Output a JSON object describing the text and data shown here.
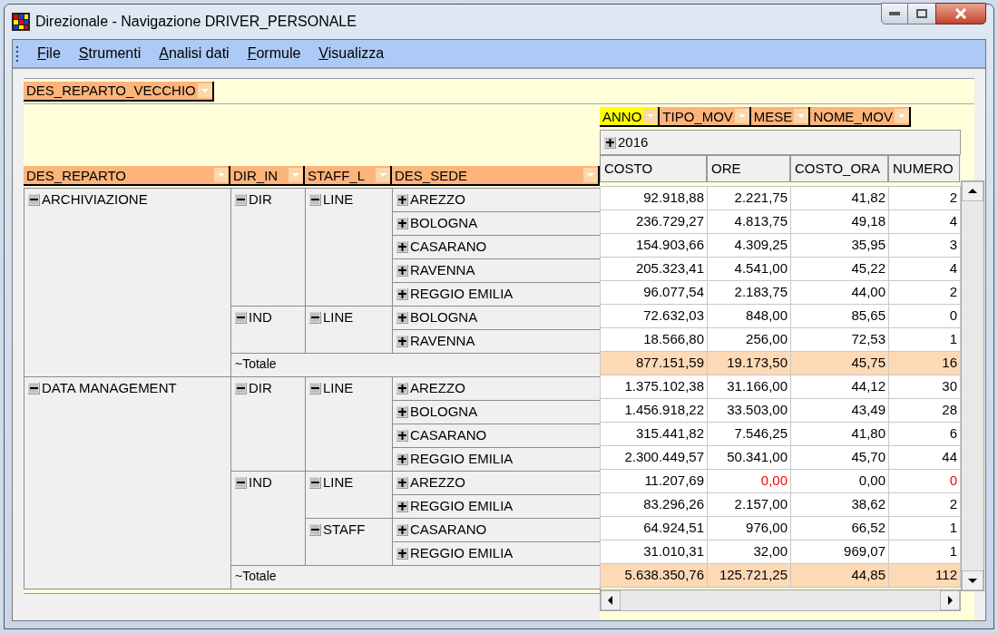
{
  "window": {
    "title": "Direzionale - Navigazione DRIVER_PERSONALE"
  },
  "menu": [
    "File",
    "Strumenti",
    "Analisi dati",
    "Formule",
    "Visualizza"
  ],
  "filter_fields": [
    {
      "label": "DES_REPARTO_VECCHIO",
      "highlighted": false
    }
  ],
  "column_fields": [
    {
      "label": "ANNO",
      "highlighted": true
    },
    {
      "label": "TIPO_MOV",
      "highlighted": false
    },
    {
      "label": "MESE",
      "highlighted": false
    },
    {
      "label": "NOME_MOV",
      "highlighted": false
    }
  ],
  "column_group": {
    "label": "2016",
    "expanded": false
  },
  "row_fields": [
    {
      "label": "DES_REPARTO",
      "highlighted": false
    },
    {
      "label": "DIR_IN",
      "highlighted": false
    },
    {
      "label": "STAFF_L",
      "highlighted": false
    },
    {
      "label": "DES_SEDE",
      "highlighted": false
    }
  ],
  "measures": [
    "COSTO",
    "ORE",
    "COSTO_ORA",
    "NUMERO"
  ],
  "groups": [
    {
      "label": "ARCHIVIAZIONE",
      "expanded": true,
      "children": [
        {
          "label": "DIR",
          "expanded": true,
          "children": [
            {
              "label": "LINE",
              "expanded": true,
              "children": [
                {
                  "label": "AREZZO",
                  "expanded": false,
                  "cells": [
                    {
                      "text": "92.918,88",
                      "alert": false
                    },
                    {
                      "text": "2.221,75",
                      "alert": false
                    },
                    {
                      "text": "41,82",
                      "alert": false
                    },
                    {
                      "text": "2",
                      "alert": false
                    }
                  ]
                },
                {
                  "label": "BOLOGNA",
                  "expanded": false,
                  "cells": [
                    {
                      "text": "236.729,27",
                      "alert": false
                    },
                    {
                      "text": "4.813,75",
                      "alert": false
                    },
                    {
                      "text": "49,18",
                      "alert": false
                    },
                    {
                      "text": "4",
                      "alert": false
                    }
                  ]
                },
                {
                  "label": "CASARANO",
                  "expanded": false,
                  "cells": [
                    {
                      "text": "154.903,66",
                      "alert": false
                    },
                    {
                      "text": "4.309,25",
                      "alert": false
                    },
                    {
                      "text": "35,95",
                      "alert": false
                    },
                    {
                      "text": "3",
                      "alert": false
                    }
                  ]
                },
                {
                  "label": "RAVENNA",
                  "expanded": false,
                  "cells": [
                    {
                      "text": "205.323,41",
                      "alert": false
                    },
                    {
                      "text": "4.541,00",
                      "alert": false
                    },
                    {
                      "text": "45,22",
                      "alert": false
                    },
                    {
                      "text": "4",
                      "alert": false
                    }
                  ]
                },
                {
                  "label": "REGGIO EMILIA",
                  "expanded": false,
                  "cells": [
                    {
                      "text": "96.077,54",
                      "alert": false
                    },
                    {
                      "text": "2.183,75",
                      "alert": false
                    },
                    {
                      "text": "44,00",
                      "alert": false
                    },
                    {
                      "text": "2",
                      "alert": false
                    }
                  ]
                }
              ]
            }
          ]
        },
        {
          "label": "IND",
          "expanded": true,
          "children": [
            {
              "label": "LINE",
              "expanded": true,
              "children": [
                {
                  "label": "BOLOGNA",
                  "expanded": false,
                  "cells": [
                    {
                      "text": "72.632,03",
                      "alert": false
                    },
                    {
                      "text": "848,00",
                      "alert": false
                    },
                    {
                      "text": "85,65",
                      "alert": false
                    },
                    {
                      "text": "0",
                      "alert": false
                    }
                  ]
                },
                {
                  "label": "RAVENNA",
                  "expanded": false,
                  "cells": [
                    {
                      "text": "18.566,80",
                      "alert": false
                    },
                    {
                      "text": "256,00",
                      "alert": false
                    },
                    {
                      "text": "72,53",
                      "alert": false
                    },
                    {
                      "text": "1",
                      "alert": false
                    }
                  ]
                }
              ]
            }
          ]
        }
      ],
      "total": {
        "label": "~Totale",
        "cells": [
          {
            "text": "877.151,59",
            "alert": false
          },
          {
            "text": "19.173,50",
            "alert": false
          },
          {
            "text": "45,75",
            "alert": false
          },
          {
            "text": "16",
            "alert": false
          }
        ]
      }
    },
    {
      "label": "DATA MANAGEMENT",
      "expanded": true,
      "children": [
        {
          "label": "DIR",
          "expanded": true,
          "children": [
            {
              "label": "LINE",
              "expanded": true,
              "children": [
                {
                  "label": "AREZZO",
                  "expanded": false,
                  "cells": [
                    {
                      "text": "1.375.102,38",
                      "alert": false
                    },
                    {
                      "text": "31.166,00",
                      "alert": false
                    },
                    {
                      "text": "44,12",
                      "alert": false
                    },
                    {
                      "text": "30",
                      "alert": false
                    }
                  ]
                },
                {
                  "label": "BOLOGNA",
                  "expanded": false,
                  "cells": [
                    {
                      "text": "1.456.918,22",
                      "alert": false
                    },
                    {
                      "text": "33.503,00",
                      "alert": false
                    },
                    {
                      "text": "43,49",
                      "alert": false
                    },
                    {
                      "text": "28",
                      "alert": false
                    }
                  ]
                },
                {
                  "label": "CASARANO",
                  "expanded": false,
                  "cells": [
                    {
                      "text": "315.441,82",
                      "alert": false
                    },
                    {
                      "text": "7.546,25",
                      "alert": false
                    },
                    {
                      "text": "41,80",
                      "alert": false
                    },
                    {
                      "text": "6",
                      "alert": false
                    }
                  ]
                },
                {
                  "label": "REGGIO EMILIA",
                  "expanded": false,
                  "cells": [
                    {
                      "text": "2.300.449,57",
                      "alert": false
                    },
                    {
                      "text": "50.341,00",
                      "alert": false
                    },
                    {
                      "text": "45,70",
                      "alert": false
                    },
                    {
                      "text": "44",
                      "alert": false
                    }
                  ]
                }
              ]
            }
          ]
        },
        {
          "label": "IND",
          "expanded": true,
          "children": [
            {
              "label": "LINE",
              "expanded": true,
              "children": [
                {
                  "label": "AREZZO",
                  "expanded": false,
                  "cells": [
                    {
                      "text": "11.207,69",
                      "alert": false
                    },
                    {
                      "text": "0,00",
                      "alert": true
                    },
                    {
                      "text": "0,00",
                      "alert": false
                    },
                    {
                      "text": "0",
                      "alert": true
                    }
                  ]
                },
                {
                  "label": "REGGIO EMILIA",
                  "expanded": false,
                  "cells": [
                    {
                      "text": "83.296,26",
                      "alert": false
                    },
                    {
                      "text": "2.157,00",
                      "alert": false
                    },
                    {
                      "text": "38,62",
                      "alert": false
                    },
                    {
                      "text": "2",
                      "alert": false
                    }
                  ]
                }
              ]
            },
            {
              "label": "STAFF",
              "expanded": true,
              "children": [
                {
                  "label": "CASARANO",
                  "expanded": false,
                  "cells": [
                    {
                      "text": "64.924,51",
                      "alert": false
                    },
                    {
                      "text": "976,00",
                      "alert": false
                    },
                    {
                      "text": "66,52",
                      "alert": false
                    },
                    {
                      "text": "1",
                      "alert": false
                    }
                  ]
                },
                {
                  "label": "REGGIO EMILIA",
                  "expanded": false,
                  "cells": [
                    {
                      "text": "31.010,31",
                      "alert": false
                    },
                    {
                      "text": "32,00",
                      "alert": false
                    },
                    {
                      "text": "969,07",
                      "alert": false
                    },
                    {
                      "text": "1",
                      "alert": false
                    }
                  ]
                }
              ]
            }
          ]
        }
      ],
      "total": {
        "label": "~Totale",
        "cells": [
          {
            "text": "5.638.350,76",
            "alert": false
          },
          {
            "text": "125.721,25",
            "alert": false
          },
          {
            "text": "44,85",
            "alert": false
          },
          {
            "text": "112",
            "alert": false
          }
        ]
      }
    }
  ]
}
